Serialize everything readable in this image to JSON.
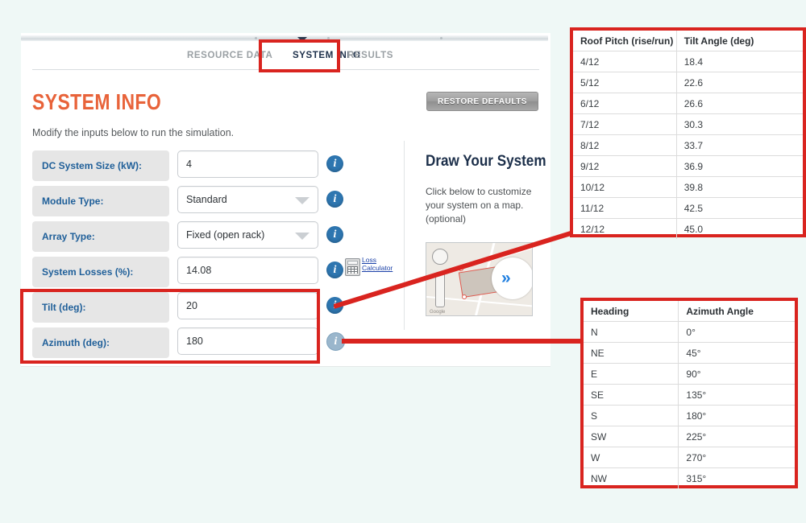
{
  "theme": {
    "accent_orange": "#e8633a",
    "label_blue": "#1f5f99",
    "info_blue": "#2e76b0",
    "annotation_red": "#d9241f",
    "page_background": "#eff8f6"
  },
  "tabs": [
    {
      "id": "resource-data",
      "label": "RESOURCE DATA",
      "active": false
    },
    {
      "id": "system-info",
      "label": "SYSTEM INFO",
      "active": true
    },
    {
      "id": "results",
      "label": "RESULTS",
      "active": false
    }
  ],
  "header": {
    "title": "SYSTEM INFO",
    "subtitle": "Modify the inputs below to run the simulation.",
    "restore_defaults_label": "RESTORE DEFAULTS"
  },
  "form": {
    "rows": [
      {
        "id": "dc-system-size",
        "label": "DC System Size (kW):",
        "value": "4",
        "type": "text"
      },
      {
        "id": "module-type",
        "label": "Module Type:",
        "value": "Standard",
        "type": "select"
      },
      {
        "id": "array-type",
        "label": "Array Type:",
        "value": "Fixed (open rack)",
        "type": "select"
      },
      {
        "id": "system-losses",
        "label": "System Losses (%):",
        "value": "14.08",
        "type": "text"
      },
      {
        "id": "tilt",
        "label": "Tilt (deg):",
        "value": "20",
        "type": "text"
      },
      {
        "id": "azimuth",
        "label": "Azimuth (deg):",
        "value": "180",
        "type": "text"
      }
    ],
    "info_icon_glyph": "i",
    "loss_calculator": {
      "line1": "Loss",
      "line2": "Calculator",
      "icon": "calculator-icon"
    }
  },
  "draw_system": {
    "title": "Draw Your System",
    "description": "Click below to customize your system on a map. (optional)",
    "map_attribution": "Google",
    "next_glyph": "»"
  },
  "roof_pitch_table": {
    "headers": [
      "Roof Pitch (rise/run)",
      "Tilt Angle (deg)"
    ],
    "rows": [
      [
        "4/12",
        "18.4"
      ],
      [
        "5/12",
        "22.6"
      ],
      [
        "6/12",
        "26.6"
      ],
      [
        "7/12",
        "30.3"
      ],
      [
        "8/12",
        "33.7"
      ],
      [
        "9/12",
        "36.9"
      ],
      [
        "10/12",
        "39.8"
      ],
      [
        "11/12",
        "42.5"
      ],
      [
        "12/12",
        "45.0"
      ]
    ]
  },
  "azimuth_table": {
    "headers": [
      "Heading",
      "Azimuth Angle"
    ],
    "rows": [
      [
        "N",
        "0°"
      ],
      [
        "NE",
        "45°"
      ],
      [
        "E",
        "90°"
      ],
      [
        "SE",
        "135°"
      ],
      [
        "S",
        "180°"
      ],
      [
        "SW",
        "225°"
      ],
      [
        "W",
        "270°"
      ],
      [
        "NW",
        "315°"
      ]
    ]
  }
}
